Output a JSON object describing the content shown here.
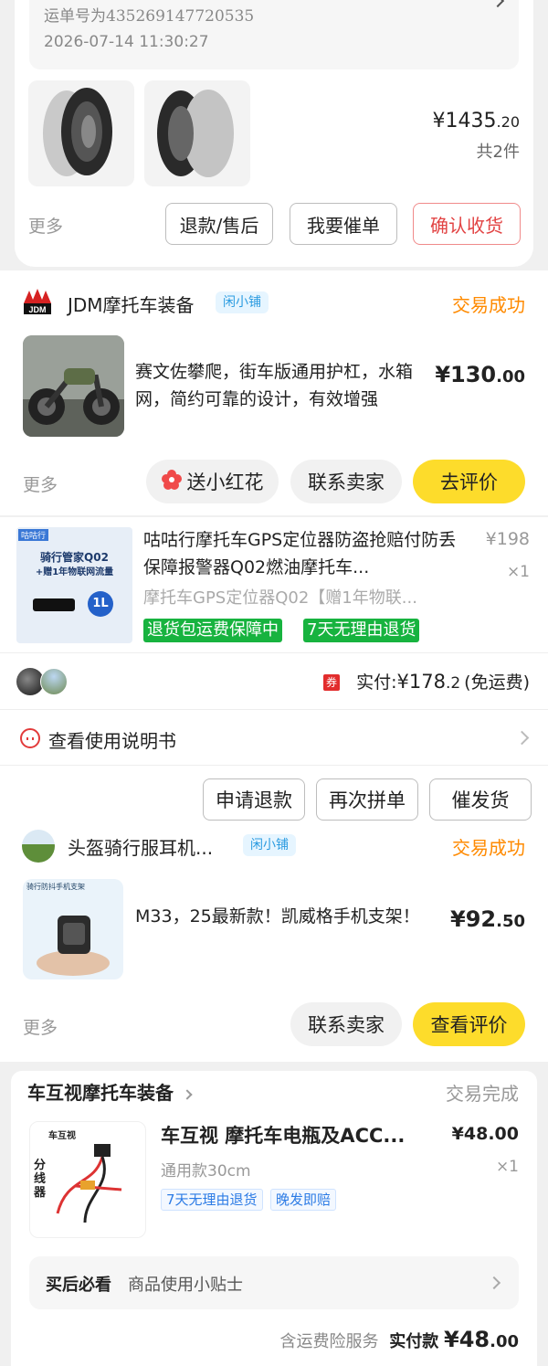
{
  "order1": {
    "tracking_text": "运单号为435269147720535",
    "time": "2026-07-14 11:30:27",
    "price_main": "¥1435",
    "price_dec": ".20",
    "count": "共2件",
    "more": "更多",
    "btn_refund": "退款/售后",
    "btn_urge": "我要催单",
    "btn_confirm": "确认收货"
  },
  "order2": {
    "shop": "JDM摩托车装备",
    "badge": "闲小铺",
    "status": "交易成功",
    "title": "赛文佐攀爬，街车版通用护杠，水箱网，简约可靠的设计，有效增强",
    "price_main": "¥130",
    "price_dec": ".00",
    "more": "更多",
    "btn_flower": "送小红花",
    "btn_contact": "联系卖家",
    "btn_review": "去评价"
  },
  "order3": {
    "ad_brand": "咕咕行",
    "ad_line1": "骑行管家Q02",
    "ad_line2": "+赠1年物联网流量",
    "title": "咕咕行摩托车GPS定位器防盗抢赔付防丢保障报警器Q02燃油摩托车...",
    "orig_price": "¥198",
    "qty": "×1",
    "spec": "摩托车GPS定位器Q02【赠1年物联...",
    "tag1": "退货包运费保障中",
    "tag2": "7天无理由退货",
    "coupon": "券",
    "paid_label": "实付:",
    "paid_main": "¥178",
    "paid_dec": ".2",
    "shipping": "(免运费)",
    "manual": "查看使用说明书",
    "btn_refund": "申请退款",
    "btn_again": "再次拼单",
    "btn_ship": "催发货"
  },
  "order4": {
    "shop": "头盔骑行服耳机...",
    "badge": "闲小铺",
    "status": "交易成功",
    "img_caption": "骑行防抖手机支架",
    "title": "M33，25最新款！凯威格手机支架！",
    "price_main": "¥92",
    "price_dec": ".50",
    "more": "更多",
    "btn_contact": "联系卖家",
    "btn_review": "查看评价"
  },
  "order5": {
    "shop": "车互视摩托车装备",
    "status": "交易完成",
    "img_brand": "车互视",
    "img_label": "分线器",
    "title": "车互视 摩托车电瓶及ACC...",
    "price": "¥48.00",
    "spec": "通用款30cm",
    "qty": "×1",
    "tag1": "7天无理由退货",
    "tag2": "晚发即赔",
    "must_read": "买后必看",
    "tips": "商品使用小贴士",
    "insurance": "含运费险服务",
    "paid_label": "实付款",
    "paid_main": "¥48",
    "paid_dec": ".00"
  }
}
